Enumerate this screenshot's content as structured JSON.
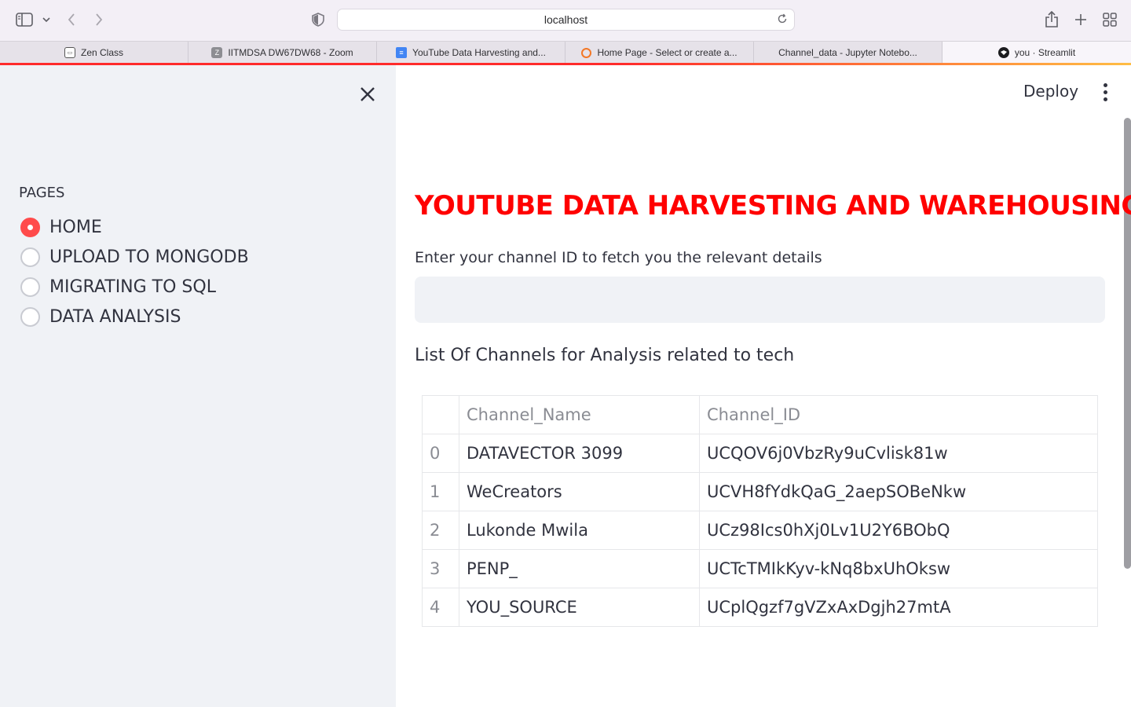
{
  "browser": {
    "url": "localhost",
    "tabs": [
      {
        "label": "Zen Class",
        "favicon": "zen-class-icon",
        "active": false
      },
      {
        "label": "IITMDSA DW67DW68 - Zoom",
        "favicon": "zoom-z-icon",
        "active": false
      },
      {
        "label": "YouTube Data Harvesting and...",
        "favicon": "google-docs-icon",
        "active": false
      },
      {
        "label": "Home Page - Select or create a...",
        "favicon": "jupyter-icon",
        "active": false
      },
      {
        "label": "Channel_data - Jupyter Notebo...",
        "favicon": "",
        "active": false
      },
      {
        "label": "you · Streamlit",
        "favicon": "streamlit-icon",
        "active": true
      }
    ]
  },
  "sidebar": {
    "section_label": "PAGES",
    "options": [
      {
        "label": "HOME",
        "selected": true
      },
      {
        "label": "UPLOAD TO MONGODB",
        "selected": false
      },
      {
        "label": "MIGRATING TO SQL",
        "selected": false
      },
      {
        "label": "DATA ANALYSIS",
        "selected": false
      }
    ]
  },
  "header": {
    "deploy_label": "Deploy"
  },
  "main": {
    "title": "YOUTUBE DATA HARVESTING AND WAREHOUSING",
    "input_label": "Enter your channel ID to fetch you the relevant details",
    "input_value": "",
    "subheading": "List Of Channels for Analysis related to tech",
    "table": {
      "columns": [
        "",
        "Channel_Name",
        "Channel_ID"
      ],
      "rows": [
        [
          "0",
          "DATAVECTOR 3099",
          "UCQOV6j0VbzRy9uCvlisk81w"
        ],
        [
          "1",
          "WeCreators",
          "UCVH8fYdkQaG_2aepSOBeNkw"
        ],
        [
          "2",
          "Lukonde Mwila",
          "UCz98Ics0hXj0Lv1U2Y6BObQ"
        ],
        [
          "3",
          "PENP_",
          "UCTcTMIkKyv-kNq8bxUhOksw"
        ],
        [
          "4",
          "YOU_SOURCE",
          "UCplQgzf7gVZxAxDgjh27mtA"
        ]
      ]
    }
  },
  "colors": {
    "accent": "#ff4b4b",
    "title": "#ff0000",
    "sidebar_bg": "#f0f2f6",
    "text": "#31333f"
  }
}
